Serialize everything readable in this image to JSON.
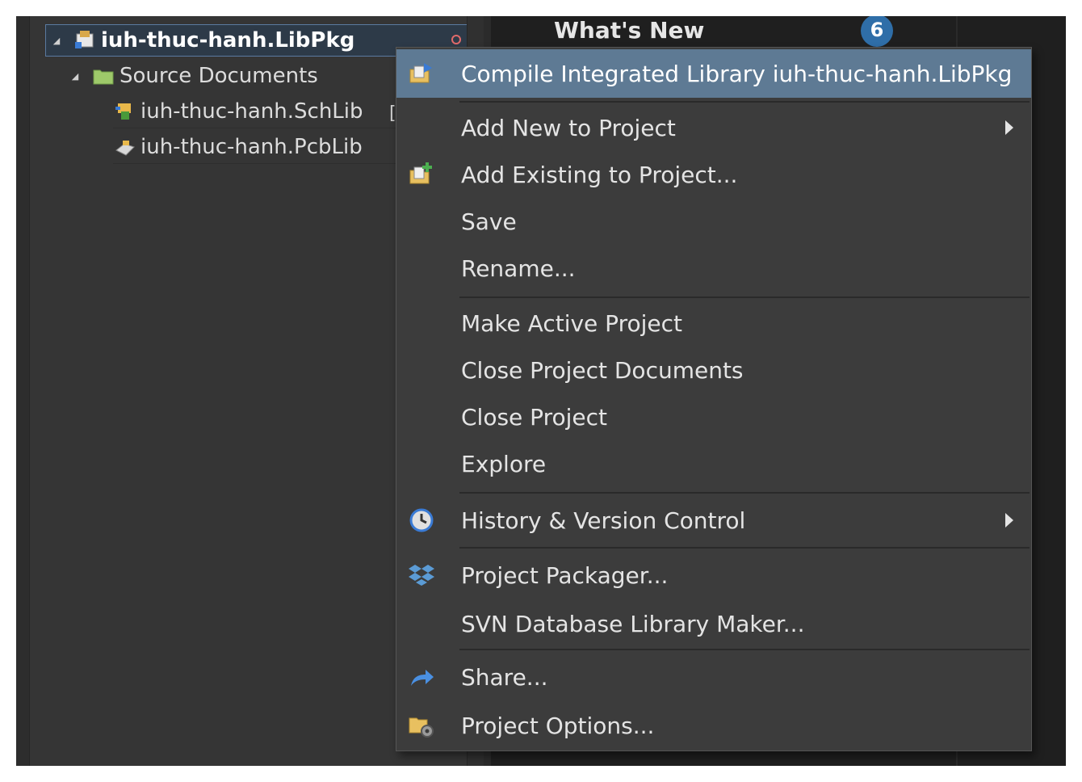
{
  "tree": {
    "project_label": "iuh-thuc-hanh.LibPkg",
    "source_folder_label": "Source Documents",
    "files": [
      "iuh-thuc-hanh.SchLib",
      "iuh-thuc-hanh.PcbLib"
    ],
    "bracket": "["
  },
  "right_panel": {
    "title": "What's New",
    "badge": "6"
  },
  "menu": {
    "items": [
      {
        "label": "Compile Integrated Library iuh-thuc-hanh.LibPkg",
        "icon": "compile-library-icon",
        "highlighted": true
      },
      {
        "label": "Add New to Project",
        "icon": "",
        "submenu": true
      },
      {
        "label": "Add Existing to Project...",
        "icon": "add-existing-icon"
      },
      {
        "label": "Save",
        "icon": ""
      },
      {
        "label": "Rename...",
        "icon": ""
      },
      {
        "label": "Make Active Project",
        "icon": ""
      },
      {
        "label": "Close Project Documents",
        "icon": ""
      },
      {
        "label": "Close Project",
        "icon": ""
      },
      {
        "label": "Explore",
        "icon": ""
      },
      {
        "label": "History & Version Control",
        "icon": "history-clock-icon",
        "submenu": true
      },
      {
        "label": "Project Packager...",
        "icon": "dropbox-icon"
      },
      {
        "label": "SVN Database Library Maker...",
        "icon": ""
      },
      {
        "label": "Share...",
        "icon": "share-arrow-icon"
      },
      {
        "label": "Project Options...",
        "icon": "project-options-icon"
      }
    ]
  },
  "colors": {
    "highlight": "#5e7a94",
    "menu_bg": "#3c3c3c",
    "panel_bg": "#353535",
    "badge": "#2f6ea8"
  }
}
